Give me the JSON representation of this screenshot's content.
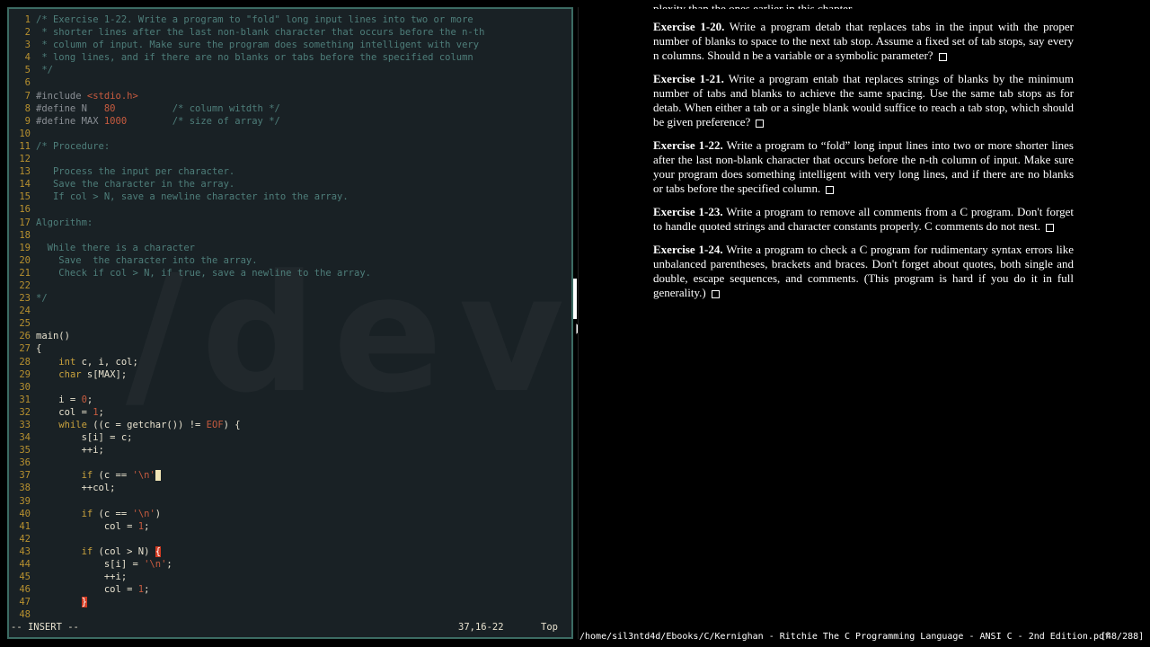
{
  "editor": {
    "watermark": "/dev/",
    "lines": [
      {
        "n": "1",
        "parts": [
          [
            "c",
            "/* Exercise 1-22. Write a program to \"fold\" long input lines into two or more"
          ]
        ]
      },
      {
        "n": "2",
        "parts": [
          [
            "c",
            " * shorter lines after the last non-blank character that occurs before the n-th"
          ]
        ]
      },
      {
        "n": "3",
        "parts": [
          [
            "c",
            " * column of input. Make sure the program does something intelligent with very"
          ]
        ]
      },
      {
        "n": "4",
        "parts": [
          [
            "c",
            " * long lines, and if there are no blanks or tabs before the specified column"
          ]
        ]
      },
      {
        "n": "5",
        "parts": [
          [
            "c",
            " */"
          ]
        ]
      },
      {
        "n": "6",
        "parts": []
      },
      {
        "n": "7",
        "parts": [
          [
            "pp",
            "#include "
          ],
          [
            "str",
            "<stdio.h>"
          ]
        ]
      },
      {
        "n": "8",
        "parts": [
          [
            "pp",
            "#define N   "
          ],
          [
            "nm",
            "80"
          ],
          [
            "c",
            "          /* column witdth */"
          ]
        ]
      },
      {
        "n": "9",
        "parts": [
          [
            "pp",
            "#define MAX "
          ],
          [
            "nm",
            "1000"
          ],
          [
            "c",
            "        /* size of array */"
          ]
        ]
      },
      {
        "n": "10",
        "parts": []
      },
      {
        "n": "11",
        "parts": [
          [
            "c",
            "/* Procedure:"
          ]
        ]
      },
      {
        "n": "12",
        "parts": []
      },
      {
        "n": "13",
        "parts": [
          [
            "c",
            "   Process the input per character."
          ]
        ]
      },
      {
        "n": "14",
        "parts": [
          [
            "c",
            "   Save the character in the array."
          ]
        ]
      },
      {
        "n": "15",
        "parts": [
          [
            "c",
            "   If col > N, save a newline character into the array."
          ]
        ]
      },
      {
        "n": "16",
        "parts": []
      },
      {
        "n": "17",
        "parts": [
          [
            "c",
            "Algorithm:"
          ]
        ]
      },
      {
        "n": "18",
        "parts": []
      },
      {
        "n": "19",
        "parts": [
          [
            "c",
            "  While there is a character"
          ]
        ]
      },
      {
        "n": "20",
        "parts": [
          [
            "c",
            "    Save  the character into the array."
          ]
        ]
      },
      {
        "n": "21",
        "parts": [
          [
            "c",
            "    Check if col > N, if true, save a newline to the array."
          ]
        ]
      },
      {
        "n": "22",
        "parts": []
      },
      {
        "n": "23",
        "parts": [
          [
            "c",
            "*/"
          ]
        ]
      },
      {
        "n": "24",
        "parts": []
      },
      {
        "n": "25",
        "parts": []
      },
      {
        "n": "26",
        "parts": [
          [
            "tx",
            "main()"
          ]
        ]
      },
      {
        "n": "27",
        "parts": [
          [
            "tx",
            "{"
          ]
        ]
      },
      {
        "n": "28",
        "parts": [
          [
            "tx",
            "    "
          ],
          [
            "kw",
            "int"
          ],
          [
            "tx",
            " c, i, col;"
          ]
        ]
      },
      {
        "n": "29",
        "parts": [
          [
            "tx",
            "    "
          ],
          [
            "kw",
            "char"
          ],
          [
            "tx",
            " s[MAX];"
          ]
        ]
      },
      {
        "n": "30",
        "parts": []
      },
      {
        "n": "31",
        "parts": [
          [
            "tx",
            "    i = "
          ],
          [
            "nm",
            "0"
          ],
          [
            "tx",
            ";"
          ]
        ]
      },
      {
        "n": "32",
        "parts": [
          [
            "tx",
            "    col = "
          ],
          [
            "nm",
            "1"
          ],
          [
            "tx",
            ";"
          ]
        ]
      },
      {
        "n": "33",
        "parts": [
          [
            "tx",
            "    "
          ],
          [
            "kw",
            "while"
          ],
          [
            "tx",
            " ((c = getchar()) != "
          ],
          [
            "nm",
            "EOF"
          ],
          [
            "tx",
            ") {"
          ]
        ]
      },
      {
        "n": "34",
        "parts": [
          [
            "tx",
            "        s[i] = c;"
          ]
        ]
      },
      {
        "n": "35",
        "parts": [
          [
            "tx",
            "        ++i;"
          ]
        ]
      },
      {
        "n": "36",
        "parts": []
      },
      {
        "n": "37",
        "parts": [
          [
            "tx",
            "        "
          ],
          [
            "kw",
            "if"
          ],
          [
            "tx",
            " (c == "
          ],
          [
            "str",
            "'\\n'"
          ],
          [
            "cursor",
            " "
          ]
        ]
      },
      {
        "n": "38",
        "parts": [
          [
            "tx",
            "        ++col;"
          ]
        ]
      },
      {
        "n": "39",
        "parts": []
      },
      {
        "n": "40",
        "parts": [
          [
            "tx",
            "        "
          ],
          [
            "kw",
            "if"
          ],
          [
            "tx",
            " (c == "
          ],
          [
            "str",
            "'\\n'"
          ],
          [
            "tx",
            ")"
          ]
        ]
      },
      {
        "n": "41",
        "parts": [
          [
            "tx",
            "            col = "
          ],
          [
            "nm",
            "1"
          ],
          [
            "tx",
            ";"
          ]
        ]
      },
      {
        "n": "42",
        "parts": []
      },
      {
        "n": "43",
        "parts": [
          [
            "tx",
            "        "
          ],
          [
            "kw",
            "if"
          ],
          [
            "tx",
            " (col > N) "
          ],
          [
            "hl",
            "{"
          ]
        ]
      },
      {
        "n": "44",
        "parts": [
          [
            "tx",
            "            s[i] = "
          ],
          [
            "str",
            "'\\n'"
          ],
          [
            "tx",
            ";"
          ]
        ]
      },
      {
        "n": "45",
        "parts": [
          [
            "tx",
            "            ++i;"
          ]
        ]
      },
      {
        "n": "46",
        "parts": [
          [
            "tx",
            "            col = "
          ],
          [
            "nm",
            "1"
          ],
          [
            "tx",
            ";"
          ]
        ]
      },
      {
        "n": "47",
        "parts": [
          [
            "tx",
            "        "
          ],
          [
            "hl",
            "}"
          ]
        ]
      },
      {
        "n": "48",
        "parts": []
      }
    ],
    "status": {
      "mode": "-- INSERT --",
      "position": "37,16-22",
      "scroll": "Top"
    }
  },
  "pdf": {
    "top_fragment": "plexity than the ones earlier in this chapter.",
    "exercises": [
      {
        "label": "Exercise 1-20.",
        "text": " Write a program detab that replaces tabs in the input with the proper number of blanks to space to the next tab stop. Assume a fixed set of tab stops, say every n columns. Should n be a variable or a symbolic parameter?"
      },
      {
        "label": "Exercise 1-21.",
        "text": " Write a program entab that replaces strings of blanks by the minimum number of tabs and blanks to achieve the same spacing. Use the same tab stops as for detab. When either a tab or a single blank would suffice to reach a tab stop, which should be given preference?"
      },
      {
        "label": "Exercise 1-22.",
        "text": " Write a program to “fold” long input lines into two or more shorter lines after the last non-blank character that occurs before the n-th column of input. Make sure your program does something intelligent with very long lines, and if there are no blanks or tabs before the specified column."
      },
      {
        "label": "Exercise 1-23.",
        "text": " Write a program to remove all comments from a C program. Don't forget to handle quoted strings and character constants properly. C comments do not nest."
      },
      {
        "label": "Exercise 1-24.",
        "text": " Write a program to check a C program for rudimentary syntax errors like unbalanced parentheses, brackets and braces. Don't forget about quotes, both single and double, escape sequences, and comments. (This program is hard if you do it in full generality.)"
      }
    ],
    "status_path": "/home/sil3ntd4d/Ebooks/C/Kernighan - Ritchie The C Programming Language - ANSI C - 2nd Edition.pdf",
    "page_count": "[48/288]"
  }
}
